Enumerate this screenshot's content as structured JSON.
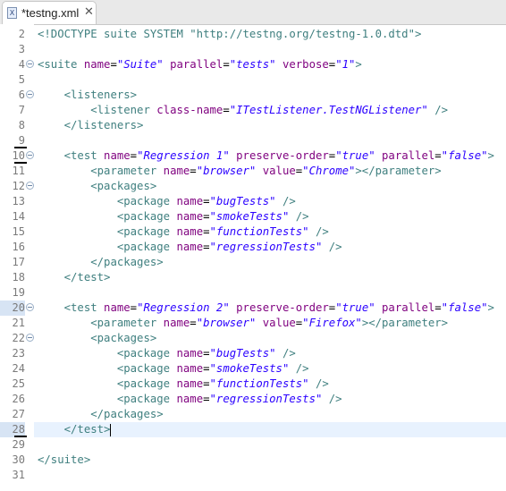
{
  "tab": {
    "title": "*testng.xml",
    "icon": "xml-file-icon",
    "icon_glyph": "X",
    "close": "✕"
  },
  "lines": [
    {
      "n": "2",
      "fold": false,
      "tokens": [
        {
          "t": "doctype",
          "v": "<!DOCTYPE suite SYSTEM \"http://testng.org/testng-1.0.dtd\">"
        }
      ]
    },
    {
      "n": "3",
      "fold": false,
      "tokens": []
    },
    {
      "n": "4",
      "fold": true,
      "tokens": [
        {
          "t": "tag",
          "v": "<suite "
        },
        {
          "t": "attr",
          "v": "name"
        },
        {
          "t": "plain",
          "v": "="
        },
        {
          "t": "val",
          "v": "\"Suite\""
        },
        {
          "t": "attr",
          "v": " parallel"
        },
        {
          "t": "plain",
          "v": "="
        },
        {
          "t": "val",
          "v": "\"tests\""
        },
        {
          "t": "attr",
          "v": " verbose"
        },
        {
          "t": "plain",
          "v": "="
        },
        {
          "t": "val",
          "v": "\"1\""
        },
        {
          "t": "tag",
          "v": ">"
        }
      ]
    },
    {
      "n": "5",
      "fold": false,
      "tokens": []
    },
    {
      "n": "6",
      "fold": true,
      "tokens": [
        {
          "t": "plain",
          "v": "    "
        },
        {
          "t": "tag",
          "v": "<listeners>"
        }
      ]
    },
    {
      "n": "7",
      "fold": false,
      "tokens": [
        {
          "t": "plain",
          "v": "        "
        },
        {
          "t": "tag",
          "v": "<listener "
        },
        {
          "t": "attr",
          "v": "class-name"
        },
        {
          "t": "plain",
          "v": "="
        },
        {
          "t": "val",
          "v": "\"ITestListener.TestNGListener\""
        },
        {
          "t": "tag",
          "v": " />"
        }
      ]
    },
    {
      "n": "8",
      "fold": false,
      "tokens": [
        {
          "t": "plain",
          "v": "    "
        },
        {
          "t": "tag",
          "v": "</listeners>"
        }
      ]
    },
    {
      "n": "9",
      "fold": false,
      "mark": true,
      "tokens": []
    },
    {
      "n": "10",
      "fold": true,
      "mark": true,
      "tokens": [
        {
          "t": "plain",
          "v": "    "
        },
        {
          "t": "tag",
          "v": "<test "
        },
        {
          "t": "attr",
          "v": "name"
        },
        {
          "t": "plain",
          "v": "="
        },
        {
          "t": "val",
          "v": "\"Regression 1\""
        },
        {
          "t": "attr",
          "v": " preserve-order"
        },
        {
          "t": "plain",
          "v": "="
        },
        {
          "t": "val",
          "v": "\"true\""
        },
        {
          "t": "attr",
          "v": " parallel"
        },
        {
          "t": "plain",
          "v": "="
        },
        {
          "t": "val",
          "v": "\"false\""
        },
        {
          "t": "tag",
          "v": ">"
        }
      ]
    },
    {
      "n": "11",
      "fold": false,
      "tokens": [
        {
          "t": "plain",
          "v": "        "
        },
        {
          "t": "tag",
          "v": "<parameter "
        },
        {
          "t": "attr",
          "v": "name"
        },
        {
          "t": "plain",
          "v": "="
        },
        {
          "t": "val",
          "v": "\"browser\""
        },
        {
          "t": "attr",
          "v": " value"
        },
        {
          "t": "plain",
          "v": "="
        },
        {
          "t": "val",
          "v": "\"Chrome\""
        },
        {
          "t": "tag",
          "v": "></parameter>"
        }
      ]
    },
    {
      "n": "12",
      "fold": true,
      "tokens": [
        {
          "t": "plain",
          "v": "        "
        },
        {
          "t": "tag",
          "v": "<packages>"
        }
      ]
    },
    {
      "n": "13",
      "fold": false,
      "tokens": [
        {
          "t": "plain",
          "v": "            "
        },
        {
          "t": "tag",
          "v": "<package "
        },
        {
          "t": "attr",
          "v": "name"
        },
        {
          "t": "plain",
          "v": "="
        },
        {
          "t": "val",
          "v": "\"bugTests\""
        },
        {
          "t": "tag",
          "v": " />"
        }
      ]
    },
    {
      "n": "14",
      "fold": false,
      "tokens": [
        {
          "t": "plain",
          "v": "            "
        },
        {
          "t": "tag",
          "v": "<package "
        },
        {
          "t": "attr",
          "v": "name"
        },
        {
          "t": "plain",
          "v": "="
        },
        {
          "t": "val",
          "v": "\"smokeTests\""
        },
        {
          "t": "tag",
          "v": " />"
        }
      ]
    },
    {
      "n": "15",
      "fold": false,
      "tokens": [
        {
          "t": "plain",
          "v": "            "
        },
        {
          "t": "tag",
          "v": "<package "
        },
        {
          "t": "attr",
          "v": "name"
        },
        {
          "t": "plain",
          "v": "="
        },
        {
          "t": "val",
          "v": "\"functionTests\""
        },
        {
          "t": "tag",
          "v": " />"
        }
      ]
    },
    {
      "n": "16",
      "fold": false,
      "tokens": [
        {
          "t": "plain",
          "v": "            "
        },
        {
          "t": "tag",
          "v": "<package "
        },
        {
          "t": "attr",
          "v": "name"
        },
        {
          "t": "plain",
          "v": "="
        },
        {
          "t": "val",
          "v": "\"regressionTests\""
        },
        {
          "t": "tag",
          "v": " />"
        }
      ]
    },
    {
      "n": "17",
      "fold": false,
      "tokens": [
        {
          "t": "plain",
          "v": "        "
        },
        {
          "t": "tag",
          "v": "</packages>"
        }
      ]
    },
    {
      "n": "18",
      "fold": false,
      "tokens": [
        {
          "t": "plain",
          "v": "    "
        },
        {
          "t": "tag",
          "v": "</test>"
        }
      ]
    },
    {
      "n": "19",
      "fold": false,
      "tokens": []
    },
    {
      "n": "20",
      "fold": true,
      "highlight": true,
      "tokens": [
        {
          "t": "plain",
          "v": "    "
        },
        {
          "t": "tag",
          "v": "<test "
        },
        {
          "t": "attr",
          "v": "name"
        },
        {
          "t": "plain",
          "v": "="
        },
        {
          "t": "val",
          "v": "\"Regression 2\""
        },
        {
          "t": "attr",
          "v": " preserve-order"
        },
        {
          "t": "plain",
          "v": "="
        },
        {
          "t": "val",
          "v": "\"true\""
        },
        {
          "t": "attr",
          "v": " parallel"
        },
        {
          "t": "plain",
          "v": "="
        },
        {
          "t": "val",
          "v": "\"false\""
        },
        {
          "t": "tag",
          "v": ">"
        }
      ]
    },
    {
      "n": "21",
      "fold": false,
      "tokens": [
        {
          "t": "plain",
          "v": "        "
        },
        {
          "t": "tag",
          "v": "<parameter "
        },
        {
          "t": "attr",
          "v": "name"
        },
        {
          "t": "plain",
          "v": "="
        },
        {
          "t": "val",
          "v": "\"browser\""
        },
        {
          "t": "attr",
          "v": " value"
        },
        {
          "t": "plain",
          "v": "="
        },
        {
          "t": "val",
          "v": "\"Firefox\""
        },
        {
          "t": "tag",
          "v": "></parameter>"
        }
      ]
    },
    {
      "n": "22",
      "fold": true,
      "tokens": [
        {
          "t": "plain",
          "v": "        "
        },
        {
          "t": "tag",
          "v": "<packages>"
        }
      ]
    },
    {
      "n": "23",
      "fold": false,
      "tokens": [
        {
          "t": "plain",
          "v": "            "
        },
        {
          "t": "tag",
          "v": "<package "
        },
        {
          "t": "attr",
          "v": "name"
        },
        {
          "t": "plain",
          "v": "="
        },
        {
          "t": "val",
          "v": "\"bugTests\""
        },
        {
          "t": "tag",
          "v": " />"
        }
      ]
    },
    {
      "n": "24",
      "fold": false,
      "tokens": [
        {
          "t": "plain",
          "v": "            "
        },
        {
          "t": "tag",
          "v": "<package "
        },
        {
          "t": "attr",
          "v": "name"
        },
        {
          "t": "plain",
          "v": "="
        },
        {
          "t": "val",
          "v": "\"smokeTests\""
        },
        {
          "t": "tag",
          "v": " />"
        }
      ]
    },
    {
      "n": "25",
      "fold": false,
      "tokens": [
        {
          "t": "plain",
          "v": "            "
        },
        {
          "t": "tag",
          "v": "<package "
        },
        {
          "t": "attr",
          "v": "name"
        },
        {
          "t": "plain",
          "v": "="
        },
        {
          "t": "val",
          "v": "\"functionTests\""
        },
        {
          "t": "tag",
          "v": " />"
        }
      ]
    },
    {
      "n": "26",
      "fold": false,
      "tokens": [
        {
          "t": "plain",
          "v": "            "
        },
        {
          "t": "tag",
          "v": "<package "
        },
        {
          "t": "attr",
          "v": "name"
        },
        {
          "t": "plain",
          "v": "="
        },
        {
          "t": "val",
          "v": "\"regressionTests\""
        },
        {
          "t": "tag",
          "v": " />"
        }
      ]
    },
    {
      "n": "27",
      "fold": false,
      "tokens": [
        {
          "t": "plain",
          "v": "        "
        },
        {
          "t": "tag",
          "v": "</packages>"
        }
      ]
    },
    {
      "n": "28",
      "fold": false,
      "current": true,
      "mark": true,
      "caret": true,
      "tokens": [
        {
          "t": "plain",
          "v": "    "
        },
        {
          "t": "tag",
          "v": "</test>"
        }
      ]
    },
    {
      "n": "29",
      "fold": false,
      "tokens": []
    },
    {
      "n": "30",
      "fold": false,
      "tokens": [
        {
          "t": "tag",
          "v": "</suite>"
        }
      ]
    },
    {
      "n": "31",
      "fold": false,
      "tokens": []
    }
  ],
  "colors": {
    "tag": "#3f7f7f",
    "attribute": "#7f007f",
    "value": "#2a00ff",
    "current_line": "#e8f2fe"
  }
}
